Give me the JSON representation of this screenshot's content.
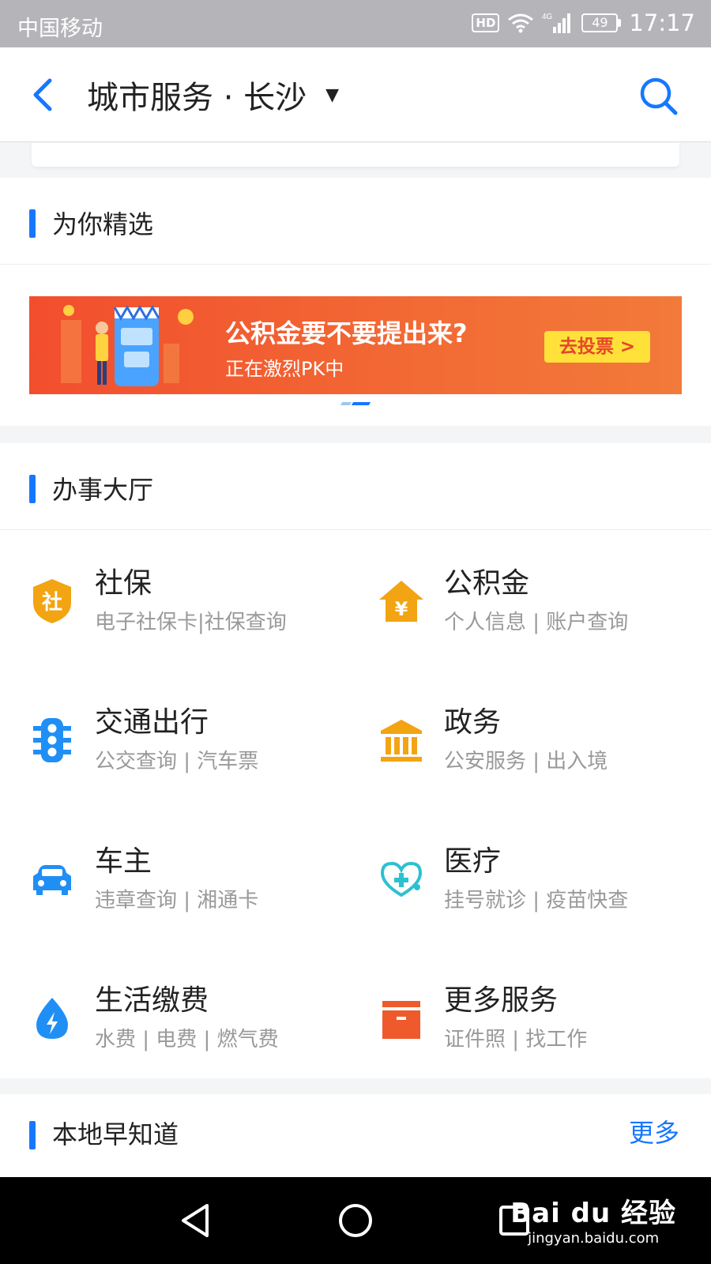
{
  "status_bar": {
    "carrier": "中国移动",
    "hd": "HD",
    "network": "4G",
    "battery": "49",
    "time": "17:17"
  },
  "nav": {
    "title": "城市服务 · 长沙"
  },
  "featured": {
    "section_title": "为你精选",
    "banner": {
      "title": "公积金要不要提出来?",
      "subtitle": "正在激烈PK中",
      "button": "去投票 >"
    }
  },
  "hall": {
    "section_title": "办事大厅",
    "services": [
      {
        "name": "社保",
        "desc": "电子社保卡|社保查询",
        "icon": "social-security-icon",
        "color": "#f2a413"
      },
      {
        "name": "公积金",
        "desc": "个人信息 | 账户查询",
        "icon": "housing-fund-icon",
        "color": "#f2a413"
      },
      {
        "name": "交通出行",
        "desc": "公交查询 | 汽车票",
        "icon": "traffic-light-icon",
        "color": "#1f8ff5"
      },
      {
        "name": "政务",
        "desc": "公安服务 | 出入境",
        "icon": "government-building-icon",
        "color": "#f2a413"
      },
      {
        "name": "车主",
        "desc": "违章查询 | 湘通卡",
        "icon": "car-icon",
        "color": "#1f8ff5"
      },
      {
        "name": "医疗",
        "desc": "挂号就诊 | 疫苗快查",
        "icon": "stethoscope-icon",
        "color": "#2cc1d1"
      },
      {
        "name": "生活缴费",
        "desc": "水费 | 电费 | 燃气费",
        "icon": "water-drop-icon",
        "color": "#1f8ff5"
      },
      {
        "name": "更多服务",
        "desc": "证件照 | 找工作",
        "icon": "box-icon",
        "color": "#ef5a2c"
      }
    ]
  },
  "local": {
    "section_title": "本地早知道",
    "more": "更多"
  },
  "watermark": {
    "brand": "Bai du 经验",
    "domain": "jingyan.baidu.com"
  }
}
